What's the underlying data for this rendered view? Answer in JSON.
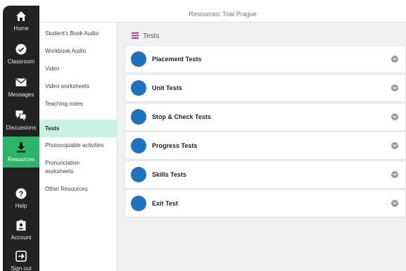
{
  "window": {
    "title": "Resources: Trial Prague"
  },
  "rail": {
    "items": [
      {
        "label": "Home",
        "icon": "home-icon"
      },
      {
        "label": "Classroom",
        "icon": "check-circle-icon"
      },
      {
        "label": "Messages",
        "icon": "envelope-icon"
      },
      {
        "label": "Discussions",
        "icon": "chat-bubbles-icon"
      },
      {
        "label": "Resources",
        "icon": "download-icon",
        "active": true
      },
      {
        "label": "Help",
        "icon": "question-icon"
      },
      {
        "label": "Account",
        "icon": "badge-icon"
      },
      {
        "label": "Sign out",
        "icon": "sign-out-icon"
      }
    ],
    "active_color": "#2ab56a"
  },
  "subnav": {
    "items": [
      {
        "label": "Student's Book Audio"
      },
      {
        "label": "Workbook Audio"
      },
      {
        "label": "Video"
      },
      {
        "label": "Video worksheets"
      },
      {
        "label": "Teaching notes"
      },
      {
        "label": "Tests",
        "active": true
      },
      {
        "label": "Photocopiable activities"
      },
      {
        "label": "Pronunciation worksheets"
      },
      {
        "label": "Other Resources"
      }
    ]
  },
  "main": {
    "section_title": "Tests",
    "rows": [
      {
        "label": "Placement Tests"
      },
      {
        "label": "Unit Tests"
      },
      {
        "label": "Stop & Check Tests"
      },
      {
        "label": "Progress Tests"
      },
      {
        "label": "Skills Tests"
      },
      {
        "label": "Exit Test"
      }
    ],
    "dot_color": "#1f72c0"
  }
}
